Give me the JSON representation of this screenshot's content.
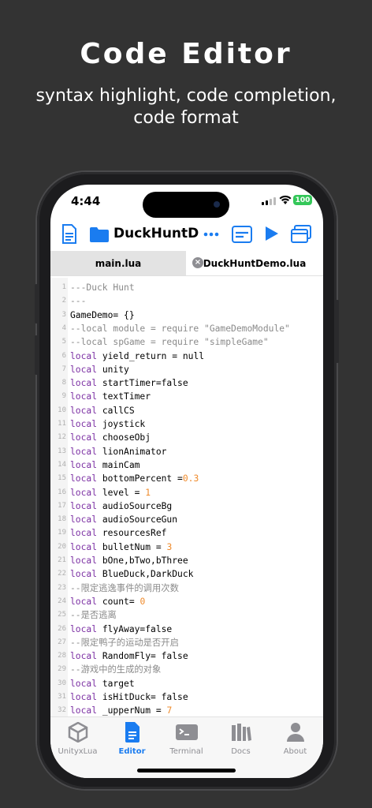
{
  "promo": {
    "title": "Code Editor",
    "subtitle_line1": "syntax highlight, code completion,",
    "subtitle_line2": "code format"
  },
  "status": {
    "time": "4:44",
    "battery": "100"
  },
  "toolbar": {
    "file_title": "DuckHuntD..."
  },
  "tabs": [
    {
      "label": "main.lua"
    },
    {
      "label": "DuckHuntDemo.lua"
    }
  ],
  "code": [
    {
      "n": "1",
      "t": "cmt",
      "s": "---Duck Hunt"
    },
    {
      "n": "2",
      "t": "cmt",
      "s": "---"
    },
    {
      "n": "3",
      "t": "plain",
      "s": "GameDemo= {}"
    },
    {
      "n": "4",
      "t": "cmt",
      "s": "--local module = require \"GameDemoModule\""
    },
    {
      "n": "5",
      "t": "cmt",
      "s": "--local spGame = require \"simpleGame\""
    },
    {
      "n": "6",
      "t": "kw",
      "k": "local",
      "s": " yield_return = null"
    },
    {
      "n": "7",
      "t": "kw",
      "k": "local",
      "s": " unity"
    },
    {
      "n": "8",
      "t": "kw",
      "k": "local",
      "s": " startTimer=false"
    },
    {
      "n": "9",
      "t": "kw",
      "k": "local",
      "s": " textTimer"
    },
    {
      "n": "10",
      "t": "kw",
      "k": "local",
      "s": " callCS"
    },
    {
      "n": "11",
      "t": "kw",
      "k": "local",
      "s": " joystick"
    },
    {
      "n": "12",
      "t": "kw",
      "k": "local",
      "s": " chooseObj"
    },
    {
      "n": "13",
      "t": "kw",
      "k": "local",
      "s": " lionAnimator"
    },
    {
      "n": "14",
      "t": "kw",
      "k": "local",
      "s": " mainCam"
    },
    {
      "n": "15",
      "t": "kw",
      "k": "local",
      "s": " bottomPercent =",
      "v": "0.3"
    },
    {
      "n": "16",
      "t": "kw",
      "k": "local",
      "s": " level = ",
      "v": "1"
    },
    {
      "n": "17",
      "t": "kw",
      "k": "local",
      "s": " audioSourceBg"
    },
    {
      "n": "18",
      "t": "kw",
      "k": "local",
      "s": " audioSourceGun"
    },
    {
      "n": "19",
      "t": "kw",
      "k": "local",
      "s": " resourcesRef"
    },
    {
      "n": "20",
      "t": "kw",
      "k": "local",
      "s": " bulletNum = ",
      "v": "3"
    },
    {
      "n": "21",
      "t": "kw",
      "k": "local",
      "s": " bOne,bTwo,bThree"
    },
    {
      "n": "22",
      "t": "kw",
      "k": "local",
      "s": " BlueDuck,DarkDuck"
    },
    {
      "n": "23",
      "t": "cmt",
      "s": "--限定逃逸事件的调用次数"
    },
    {
      "n": "24",
      "t": "kw",
      "k": "local",
      "s": " count= ",
      "v": "0"
    },
    {
      "n": "25",
      "t": "cmt",
      "s": "--是否逃离"
    },
    {
      "n": "26",
      "t": "kw",
      "k": "local",
      "s": " flyAway=false"
    },
    {
      "n": "27",
      "t": "cmt",
      "s": "--限定鸭子的运动是否开启"
    },
    {
      "n": "28",
      "t": "kw",
      "k": "local",
      "s": " RandomFly= false"
    },
    {
      "n": "29",
      "t": "cmt",
      "s": "--游戏中的生成的对象"
    },
    {
      "n": "30",
      "t": "kw",
      "k": "local",
      "s": " target"
    },
    {
      "n": "31",
      "t": "kw",
      "k": "local",
      "s": " isHitDuck= false"
    },
    {
      "n": "32",
      "t": "kw",
      "k": "local",
      "s": " _upperNum = ",
      "v": "7"
    }
  ],
  "tabbar": [
    {
      "label": "UnityxLua",
      "icon": "unity-cube-icon"
    },
    {
      "label": "Editor",
      "icon": "document-icon",
      "active": true
    },
    {
      "label": "Terminal",
      "icon": "terminal-icon"
    },
    {
      "label": "Docs",
      "icon": "books-icon"
    },
    {
      "label": "About",
      "icon": "person-icon"
    }
  ],
  "colors": {
    "accent": "#1a7cf0",
    "keyword": "#7b2fa3",
    "number": "#ef8b2c",
    "comment": "#8a8a8a",
    "battery": "#34c759"
  }
}
